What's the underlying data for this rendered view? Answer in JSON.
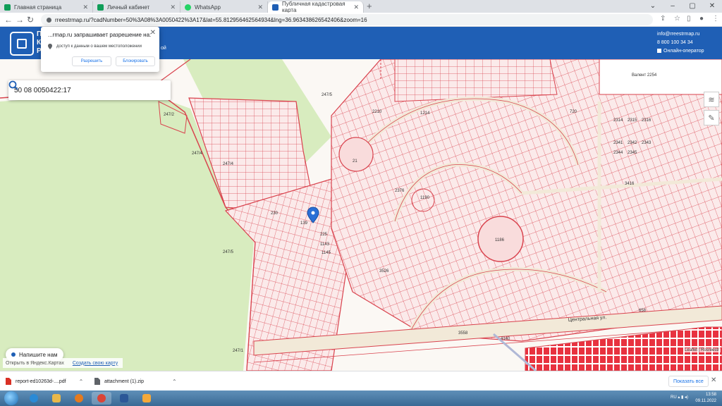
{
  "browser": {
    "tabs": [
      {
        "label": "Главная страница",
        "icon": "landmark-icon",
        "color": "#0f9d58"
      },
      {
        "label": "Личный кабинет",
        "icon": "landmark-icon",
        "color": "#0f9d58"
      },
      {
        "label": "WhatsApp",
        "icon": "whatsapp-icon",
        "color": "#25d366"
      },
      {
        "label": "Публичная кадастровая карта",
        "icon": "map-icon",
        "color": "#1f5fb5"
      }
    ],
    "new_tab": "+",
    "url": "rreestrmap.ru/?cadNumber=50%3A08%3A0050422%3A17&lat=55.812956462564934&lng=36.963438626542406&zoom=16"
  },
  "permission": {
    "title": "...rmap.ru запрашивает разрешение на:",
    "desc": "доступ к данным о вашем местоположении",
    "allow": "Разрешить",
    "block": "Блокировать"
  },
  "header": {
    "letters": [
      "П",
      "К",
      "Р"
    ],
    "fragment": "ой",
    "email": "info@rreestrmap.ru",
    "phone": "8 800 100 34 34",
    "operator": "Онлайн-оператор"
  },
  "map": {
    "search_value": "50 08 0050422:17",
    "chat": "Напишите нам",
    "yandex": "Открыть в Яндекс.Картах",
    "create": "Создать свою карту",
    "attribution": "Leaflet | Rosreestr",
    "street": "Центральная ул.",
    "labels": [
      "247/5",
      "247/2",
      "247/4",
      "247/4",
      "247/5",
      "247/1",
      "Валент 2254",
      "1214",
      "720",
      "2210",
      "1190",
      "3526",
      "1186",
      "3416",
      "3558",
      "658",
      "2376",
      "21",
      "230",
      "139",
      "225",
      "1143",
      "1145",
      "4140",
      "2314",
      "2315",
      "2316",
      "2341",
      "2342",
      "2343",
      "2344",
      "2345"
    ],
    "colors": {
      "parcel_fill": "#f9dcdc",
      "parcel_line": "#d9434e",
      "forest": "#d8ecbf",
      "road": "#f2e9d8",
      "built": "#e8323f"
    }
  },
  "downloads": [
    {
      "name": "report-ed10263d-....pdf",
      "icon": "pdf-icon"
    },
    {
      "name": "attachment (1).zip",
      "icon": "zip-icon"
    }
  ],
  "downloads_show_all": "Показать все",
  "taskbar": {
    "apps": [
      {
        "icon": "ie-icon",
        "color": "#2a8ad6"
      },
      {
        "icon": "folder-icon",
        "color": "#e8b84a"
      },
      {
        "icon": "media-player-icon",
        "color": "#e47a1e"
      },
      {
        "icon": "chrome-icon",
        "color": "#db4437"
      },
      {
        "icon": "word-icon",
        "color": "#2b5797"
      },
      {
        "icon": "app-icon",
        "color": "#f4a93a"
      }
    ],
    "lang": "RU",
    "time": "13:58",
    "date": "09.11.2022"
  }
}
